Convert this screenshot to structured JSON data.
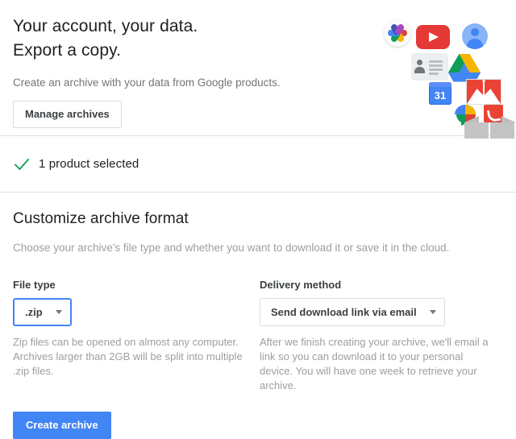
{
  "hero": {
    "title_line1": "Your account, your data.",
    "title_line2": "Export a copy.",
    "subtitle": "Create an archive with your data from Google products.",
    "manage_archives_label": "Manage archives"
  },
  "icons": {
    "photos": "google-photos-icon",
    "youtube": "youtube-icon",
    "avatar": "account-avatar-icon",
    "contacts": "contacts-card-icon",
    "drive": "google-drive-icon",
    "calendar": "google-calendar-icon",
    "calendar_day": "31",
    "gmail": "gmail-icon",
    "hangouts": "hangouts-icon",
    "box": "archive-box-icon"
  },
  "selection": {
    "check_icon": "check-icon",
    "text": "1 product selected"
  },
  "customize": {
    "title": "Customize archive format",
    "description": "Choose your archive's file type and whether you want to download it or save it in the cloud.",
    "file_type": {
      "label": "File type",
      "value": ".zip",
      "help": "Zip files can be opened on almost any computer. Archives larger than 2GB will be split into multiple .zip files."
    },
    "delivery_method": {
      "label": "Delivery method",
      "value": "Send download link via email",
      "help": "After we finish creating your archive, we'll email a link so you can download it to your personal device. You will have one week to retrieve your archive."
    },
    "create_archive_label": "Create archive"
  },
  "colors": {
    "primary_blue": "#4285f4",
    "check_green": "#0f9d58",
    "text_primary": "#212121",
    "text_muted": "#9e9e9e",
    "divider": "#e0e0e0",
    "youtube_red": "#e53935",
    "gmail_red": "#ea4335"
  }
}
